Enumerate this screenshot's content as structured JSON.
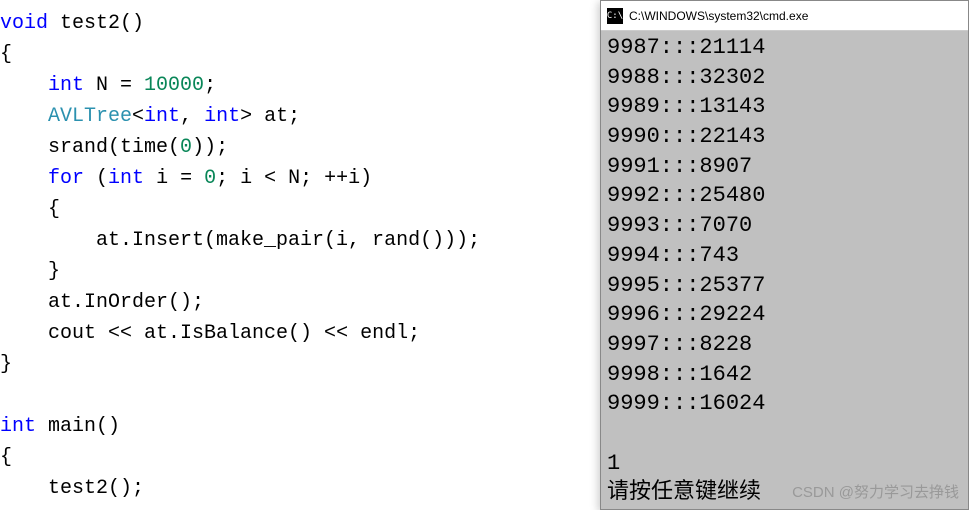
{
  "code": {
    "line1_kw": "void",
    "line1_fn": " test2",
    "line1_paren": "()",
    "line2": "{",
    "line3_indent": "    ",
    "line3_kw": "int",
    "line3_rest": " N = ",
    "line3_num": "10000",
    "line3_end": ";",
    "line4_indent": "    ",
    "line4_type": "AVLTree",
    "line4_lt": "<",
    "line4_kw1": "int",
    "line4_comma": ", ",
    "line4_kw2": "int",
    "line4_gt": ">",
    "line4_rest": " at;",
    "line5_indent": "    ",
    "line5_fn": "srand",
    "line5_rest": "(time(",
    "line5_num": "0",
    "line5_end": "));",
    "line6_indent": "    ",
    "line6_kw": "for",
    "line6_open": " (",
    "line6_kw2": "int",
    "line6_rest": " i = ",
    "line6_num": "0",
    "line6_rest2": "; i < N; ++i)",
    "line7": "    {",
    "line8_indent": "        ",
    "line8_rest": "at.Insert(make_pair(i, rand()));",
    "line9": "    }",
    "line10_indent": "    ",
    "line10_rest": "at.InOrder();",
    "line11_indent": "    ",
    "line11_rest": "cout << at.IsBalance() << endl;",
    "line12": "}",
    "line13": "",
    "line14_kw": "int",
    "line14_fn": " main",
    "line14_paren": "()",
    "line15": "{",
    "line16_indent": "    ",
    "line16_rest": "test2();"
  },
  "console": {
    "icon_text": "C:\\",
    "title": "C:\\WINDOWS\\system32\\cmd.exe",
    "lines": [
      "9987:::21114",
      "9988:::32302",
      "9989:::13143",
      "9990:::22143",
      "9991:::8907",
      "9992:::25480",
      "9993:::7070",
      "9994:::743",
      "9995:::25377",
      "9996:::29224",
      "9997:::8228",
      "9998:::1642",
      "9999:::16024",
      "",
      "1",
      "请按任意键继续"
    ]
  },
  "watermark": "CSDN @努力学习去挣钱"
}
